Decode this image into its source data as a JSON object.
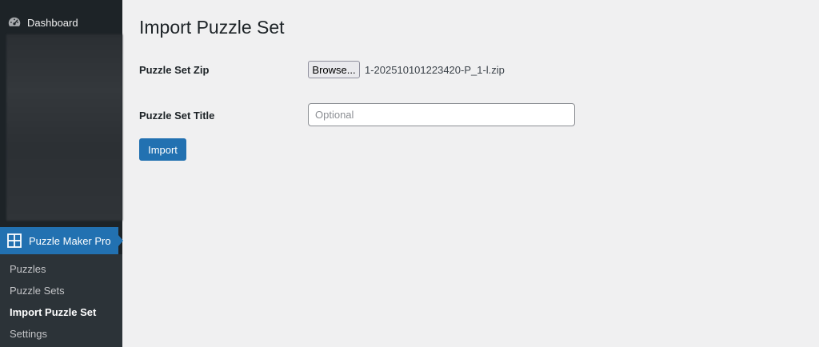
{
  "sidebar": {
    "dashboard_label": "Dashboard",
    "dashboard_icon": "dashboard-gauge-icon",
    "plugin_label": "Puzzle Maker Pro",
    "plugin_icon": "grid-icon",
    "submenu": [
      {
        "label": "Puzzles",
        "current": false
      },
      {
        "label": "Puzzle Sets",
        "current": false
      },
      {
        "label": "Import Puzzle Set",
        "current": true
      },
      {
        "label": "Settings",
        "current": false
      }
    ]
  },
  "main": {
    "title": "Import Puzzle Set",
    "zip_label": "Puzzle Set Zip",
    "browse_label": "Browse...",
    "file_name": "1-202510101223420-P_1-l.zip",
    "title_label": "Puzzle Set Title",
    "title_value": "",
    "title_placeholder": "Optional",
    "import_label": "Import"
  },
  "colors": {
    "sidebar_bg": "#1d2327",
    "submenu_bg": "#2c3338",
    "accent": "#2271b1",
    "page_bg": "#f0f0f1"
  }
}
